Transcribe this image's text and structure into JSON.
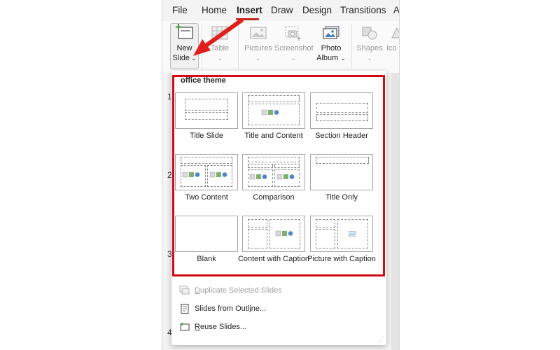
{
  "menu": {
    "tabs": [
      {
        "label": "File"
      },
      {
        "label": "Home"
      },
      {
        "label": "Insert",
        "active": true
      },
      {
        "label": "Draw"
      },
      {
        "label": "Design"
      },
      {
        "label": "Transitions"
      },
      {
        "label": "A"
      }
    ]
  },
  "ribbon": {
    "new_slide": {
      "line1": "New",
      "line2": "Slide",
      "chevron": "⌄"
    },
    "table": {
      "label": "Table",
      "chevron": "⌄"
    },
    "pictures": {
      "label": "Pictures",
      "chevron": "⌄"
    },
    "screenshot": {
      "label": "Screenshot",
      "chevron": "⌄"
    },
    "photo_album": {
      "line1": "Photo",
      "line2": "Album",
      "chevron": "⌄"
    },
    "shapes": {
      "label": "Shapes",
      "chevron": "⌄"
    },
    "icons": {
      "label": "Ico"
    }
  },
  "slide_numbers": [
    "1",
    "2",
    "3",
    "4"
  ],
  "gallery": {
    "theme_title": "office theme",
    "layouts": [
      {
        "label": "Title Slide"
      },
      {
        "label": "Title and Content"
      },
      {
        "label": "Section Header"
      },
      {
        "label": "Two Content"
      },
      {
        "label": "Comparison"
      },
      {
        "label": "Title Only"
      },
      {
        "label": "Blank"
      },
      {
        "label": "Content with Caption"
      },
      {
        "label": "Picture with Caption"
      }
    ]
  },
  "menu_items": [
    {
      "ul": "D",
      "rest": "uplicate Selected Slides",
      "disabled": true
    },
    {
      "pre": "Slides from Outl",
      "ul": "i",
      "post": "ne..."
    },
    {
      "ul": "R",
      "rest": "euse Slides..."
    }
  ],
  "colors": {
    "highlight": "#d10a14",
    "accent_underline": "#c42b1c",
    "arrow": "#e01e1e"
  }
}
